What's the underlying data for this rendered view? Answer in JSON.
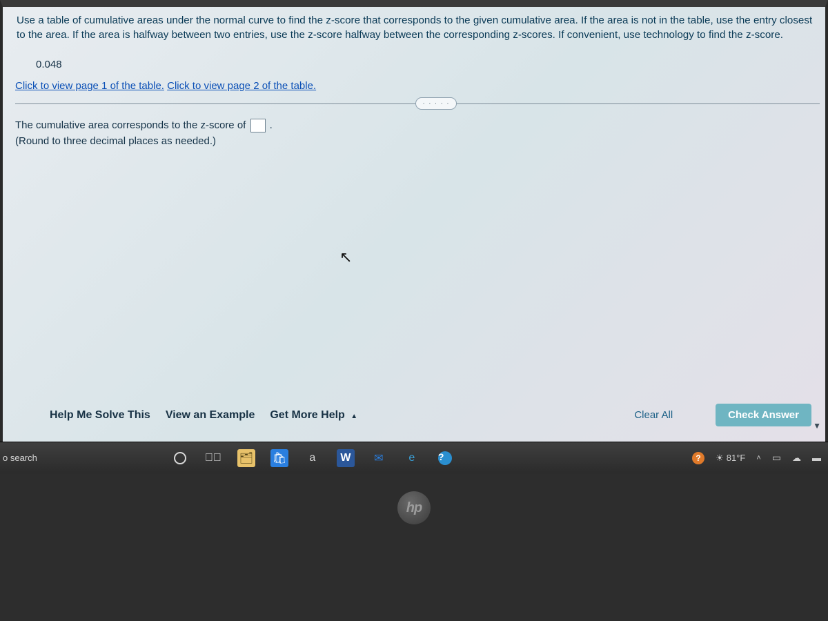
{
  "problem": {
    "text": "Use a table of cumulative areas under the normal curve to find the z-score that corresponds to the given cumulative area. If the area is not in the table, use the entry closest to the area. If the area is halfway between two entries, use the z-score halfway between the corresponding z-scores. If convenient, use technology to find the z-score.",
    "given_value": "0.048",
    "link_page1": "Click to view page 1 of the table.",
    "link_page2": "Click to view page 2 of the table.",
    "divider_dots": "· · · · ·"
  },
  "answer": {
    "prefix": "The cumulative area corresponds to the z-score of ",
    "suffix": ".",
    "hint": "(Round to three decimal places as needed.)",
    "value": ""
  },
  "footer": {
    "help_me": "Help Me Solve This",
    "view_example": "View an Example",
    "get_more_help": "Get More Help",
    "clear_all": "Clear All",
    "check_answer": "Check Answer"
  },
  "taskbar": {
    "search": "o search",
    "a_label": "a",
    "temp": "81°F"
  },
  "logo": "hp"
}
